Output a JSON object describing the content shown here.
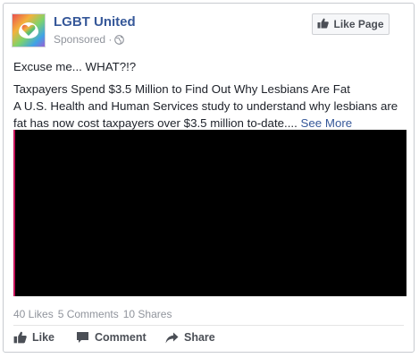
{
  "header": {
    "page_name": "LGBT United",
    "sponsored": "Sponsored ·",
    "avatar_icon": "heart-logo-icon",
    "globe_icon": "globe-icon",
    "like_page_label": "Like Page",
    "like_page_icon": "thumbs-up-icon"
  },
  "post": {
    "line1": "Excuse me... WHAT?!?",
    "line2": "Taxpayers Spend $3.5 Million to Find Out Why Lesbians Are Fat",
    "line3": "A U.S. Health and Human Services study to understand why lesbians are fat has now cost taxpayers over $3.5 million to-date....",
    "see_more": "See More"
  },
  "stats": {
    "likes": "40 Likes",
    "comments": "5 Comments",
    "shares": "10 Shares"
  },
  "actions": {
    "like_label": "Like",
    "comment_label": "Comment",
    "share_label": "Share"
  },
  "colors": {
    "link_blue": "#365899",
    "muted_gray": "#90949c",
    "action_gray": "#4b4f56"
  }
}
